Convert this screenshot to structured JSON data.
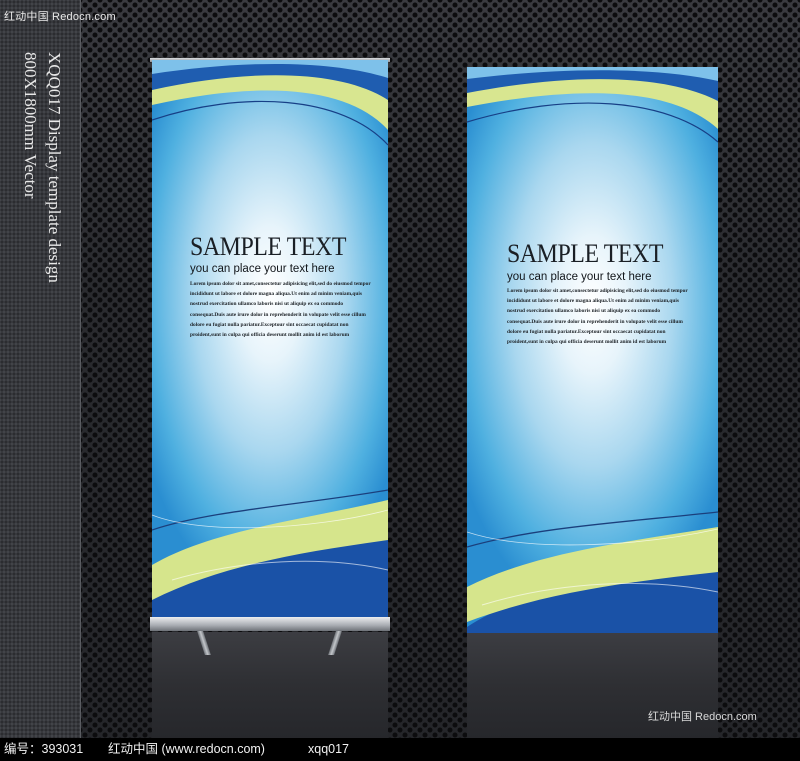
{
  "corner_mark": "红动中国 Redocn.com",
  "side_title": {
    "line1": "XQQ017 Display template design",
    "line2": "800X1800mm Vector"
  },
  "banners": [
    {
      "headline": "SAMPLE TEXT",
      "subline": "you can place your text here",
      "body": "Lorem ipsum dolor sit amet,consectetur adipisicing elit,sed do eiusmod tempor\nincididunt ut labore et dolore magna aliqua.Ut enim ad minim veniam,quis\nnostrud exercitation ullamco laboris nisi ut aliquip ex ea commodo\nconsequat.Duis aute irure dolor in reprehenderit in volupate velit esse cillum\ndolore eu fugiat nulla pariatur.Exceptour sint occaecat cupidatat non\nproident,sunt in culpa qui officia deserunt mollit anim id est laborum"
    },
    {
      "headline": "SAMPLE TEXT",
      "subline": "you can place your text here",
      "body": "Lorem ipsum dolor sit amet,consectetur adipisicing elit,sed do eiusmod tempor\nincididunt ut labore et dolore magna aliqua.Ut enim ad minim veniam,quis\nnostrud exercitation ullamco laboris nisi ut aliquip ex ea commodo\nconsequat.Duis aute irure dolor in reprehenderit in volupate velit esse cillum\ndolore eu fugiat nulla pariatur.Exceptour sint occaecat cupidatat non\nproident,sunt in culpa qui officia deserunt mollit anim id est laborum"
    }
  ],
  "watermark": "红动中国 Redocn.com",
  "footer": {
    "id_label": "编号：393031",
    "site": "红动中国 (www.redocn.com)",
    "code": "xqq017"
  },
  "colors": {
    "banner_blue": "#2a8ed1",
    "swoosh_green": "#d7e58f",
    "swoosh_navy": "#1a4fa3"
  }
}
